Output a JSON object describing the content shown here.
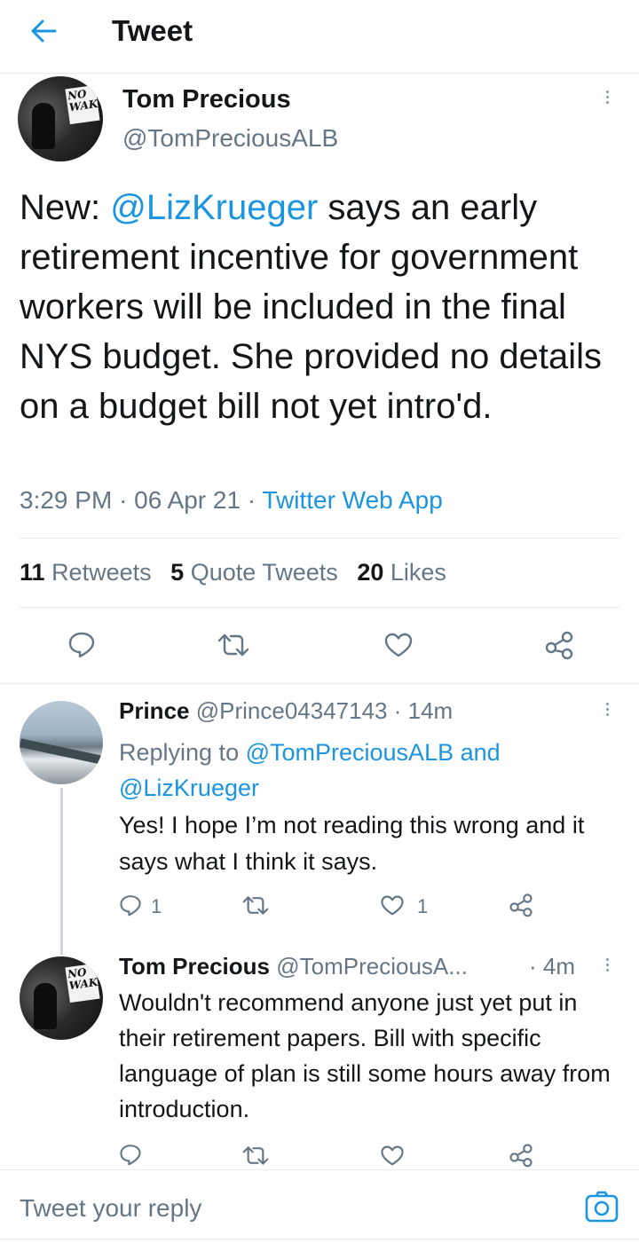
{
  "header": {
    "title": "Tweet"
  },
  "main_tweet": {
    "author_name": "Tom Precious",
    "author_handle": "@TomPreciousALB",
    "avatar_text": "NO WAKE",
    "text_prefix": "New: ",
    "mention": "@LizKrueger",
    "text_rest": " says an early retirement incentive for government workers will be included in the final NYS budget. She provided no details on a budget bill not yet intro'd.",
    "time": "3:29 PM",
    "date": "06 Apr 21",
    "source": "Twitter Web App",
    "sep": " · ",
    "stats": {
      "retweets_count": "11",
      "retweets_label": "Retweets",
      "quotes_count": "5",
      "quotes_label": "Quote Tweets",
      "likes_count": "20",
      "likes_label": "Likes"
    }
  },
  "reply1": {
    "author_name": "Prince",
    "author_handle": "@Prince04347143",
    "time": "· 14m",
    "replying_prefix": "Replying to ",
    "replying_to_1": "@TomPreciousALB",
    "replying_and": " and",
    "replying_to_2": "@LizKrueger",
    "text": "Yes! I hope I’m not reading this wrong and it says what I think it says.",
    "reply_count": "1",
    "like_count": "1"
  },
  "reply2": {
    "author_name": "Tom Precious",
    "author_handle": "@TomPreciousA...",
    "time": "· 4m",
    "avatar_text": "NO WAKE",
    "text": "Wouldn't recommend anyone just yet put in their retirement papers. Bill with specific language of plan is still some hours away from introduction."
  },
  "composer": {
    "placeholder": "Tweet your reply"
  },
  "colors": {
    "accent": "#1b95e0",
    "secondary": "#657786",
    "divider": "#e6ecf0"
  }
}
